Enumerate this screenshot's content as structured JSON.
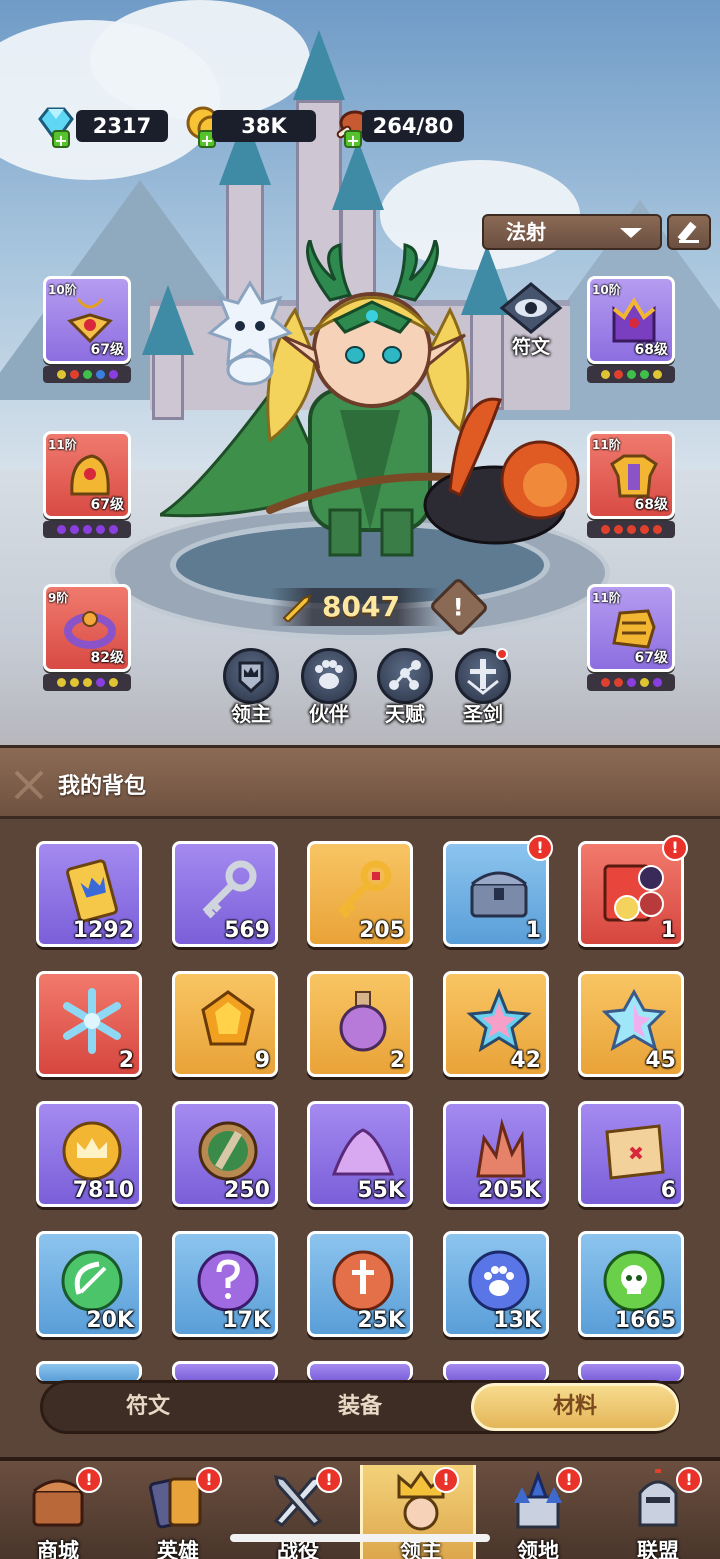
{
  "resources": {
    "gems": "2317",
    "gold": "38K",
    "stamina": "264/80"
  },
  "class_select": {
    "value": "法射"
  },
  "rune_button": {
    "label": "符文"
  },
  "equipment": {
    "left": [
      {
        "tier": "10阶",
        "level": "67级",
        "color": "purple",
        "item": "amulet"
      },
      {
        "tier": "11阶",
        "level": "67级",
        "color": "red",
        "item": "helmet"
      },
      {
        "tier": "9阶",
        "level": "82级",
        "color": "red",
        "item": "ring"
      }
    ],
    "right": [
      {
        "tier": "10阶",
        "level": "68级",
        "color": "purple",
        "item": "crown"
      },
      {
        "tier": "11阶",
        "level": "68级",
        "color": "red",
        "item": "armor"
      },
      {
        "tier": "11阶",
        "level": "67级",
        "color": "purple",
        "item": "gauntlet"
      }
    ]
  },
  "power": {
    "value": "8047"
  },
  "modes": [
    {
      "label": "领主",
      "icon": "crown-shield-icon"
    },
    {
      "label": "伙伴",
      "icon": "paw-icon"
    },
    {
      "label": "天赋",
      "icon": "talent-tree-icon"
    },
    {
      "label": "圣剑",
      "icon": "holy-sword-icon"
    }
  ],
  "inventory": {
    "title": "我的背包",
    "items": [
      {
        "name": "ticket",
        "count": "1292",
        "color": "purple"
      },
      {
        "name": "silver-key",
        "count": "569",
        "color": "purple"
      },
      {
        "name": "gold-key",
        "count": "205",
        "color": "gold"
      },
      {
        "name": "treasure-chest",
        "count": "1",
        "color": "blue",
        "badge": "!"
      },
      {
        "name": "hero-summon-card",
        "count": "1",
        "color": "red",
        "badge": "!"
      },
      {
        "name": "snowflake",
        "count": "2",
        "color": "red"
      },
      {
        "name": "amber-crystal",
        "count": "9",
        "color": "gold"
      },
      {
        "name": "potion",
        "count": "2",
        "color": "gold"
      },
      {
        "name": "rainbow-star",
        "count": "42",
        "color": "gold"
      },
      {
        "name": "crystal-star",
        "count": "45",
        "color": "gold"
      },
      {
        "name": "crown-coin",
        "count": "7810",
        "color": "purple"
      },
      {
        "name": "sword-coin",
        "count": "250",
        "color": "purple"
      },
      {
        "name": "purple-dust",
        "count": "55K",
        "color": "purple"
      },
      {
        "name": "red-crystal",
        "count": "205K",
        "color": "purple"
      },
      {
        "name": "treasure-map",
        "count": "6",
        "color": "purple"
      },
      {
        "name": "bow-orb",
        "count": "20K",
        "color": "blue"
      },
      {
        "name": "mystery-orb",
        "count": "17K",
        "color": "blue"
      },
      {
        "name": "sword-orb",
        "count": "25K",
        "color": "blue"
      },
      {
        "name": "paw-orb",
        "count": "13K",
        "color": "blue"
      },
      {
        "name": "skull-orb",
        "count": "1665",
        "color": "blue"
      }
    ]
  },
  "tabs": [
    {
      "label": "符文",
      "active": false
    },
    {
      "label": "装备",
      "active": false
    },
    {
      "label": "材料",
      "active": true
    }
  ],
  "nav": [
    {
      "label": "商城",
      "icon": "shop-chest-icon",
      "badge": "!"
    },
    {
      "label": "英雄",
      "icon": "hero-cards-icon",
      "badge": "!"
    },
    {
      "label": "战役",
      "icon": "battle-swords-icon",
      "badge": "!"
    },
    {
      "label": "领主",
      "icon": "lord-crown-icon",
      "badge": "!",
      "active": true
    },
    {
      "label": "领地",
      "icon": "territory-castle-icon",
      "badge": "!"
    },
    {
      "label": "联盟",
      "icon": "alliance-knight-icon",
      "badge": "!"
    }
  ],
  "colors": {
    "gem_frame_purple": "#8d6ee0",
    "gem_frame_red": "#d84b44",
    "panel_brown": "#5b4538",
    "tab_active": "#e4b659",
    "badge_red": "#e8322a"
  }
}
